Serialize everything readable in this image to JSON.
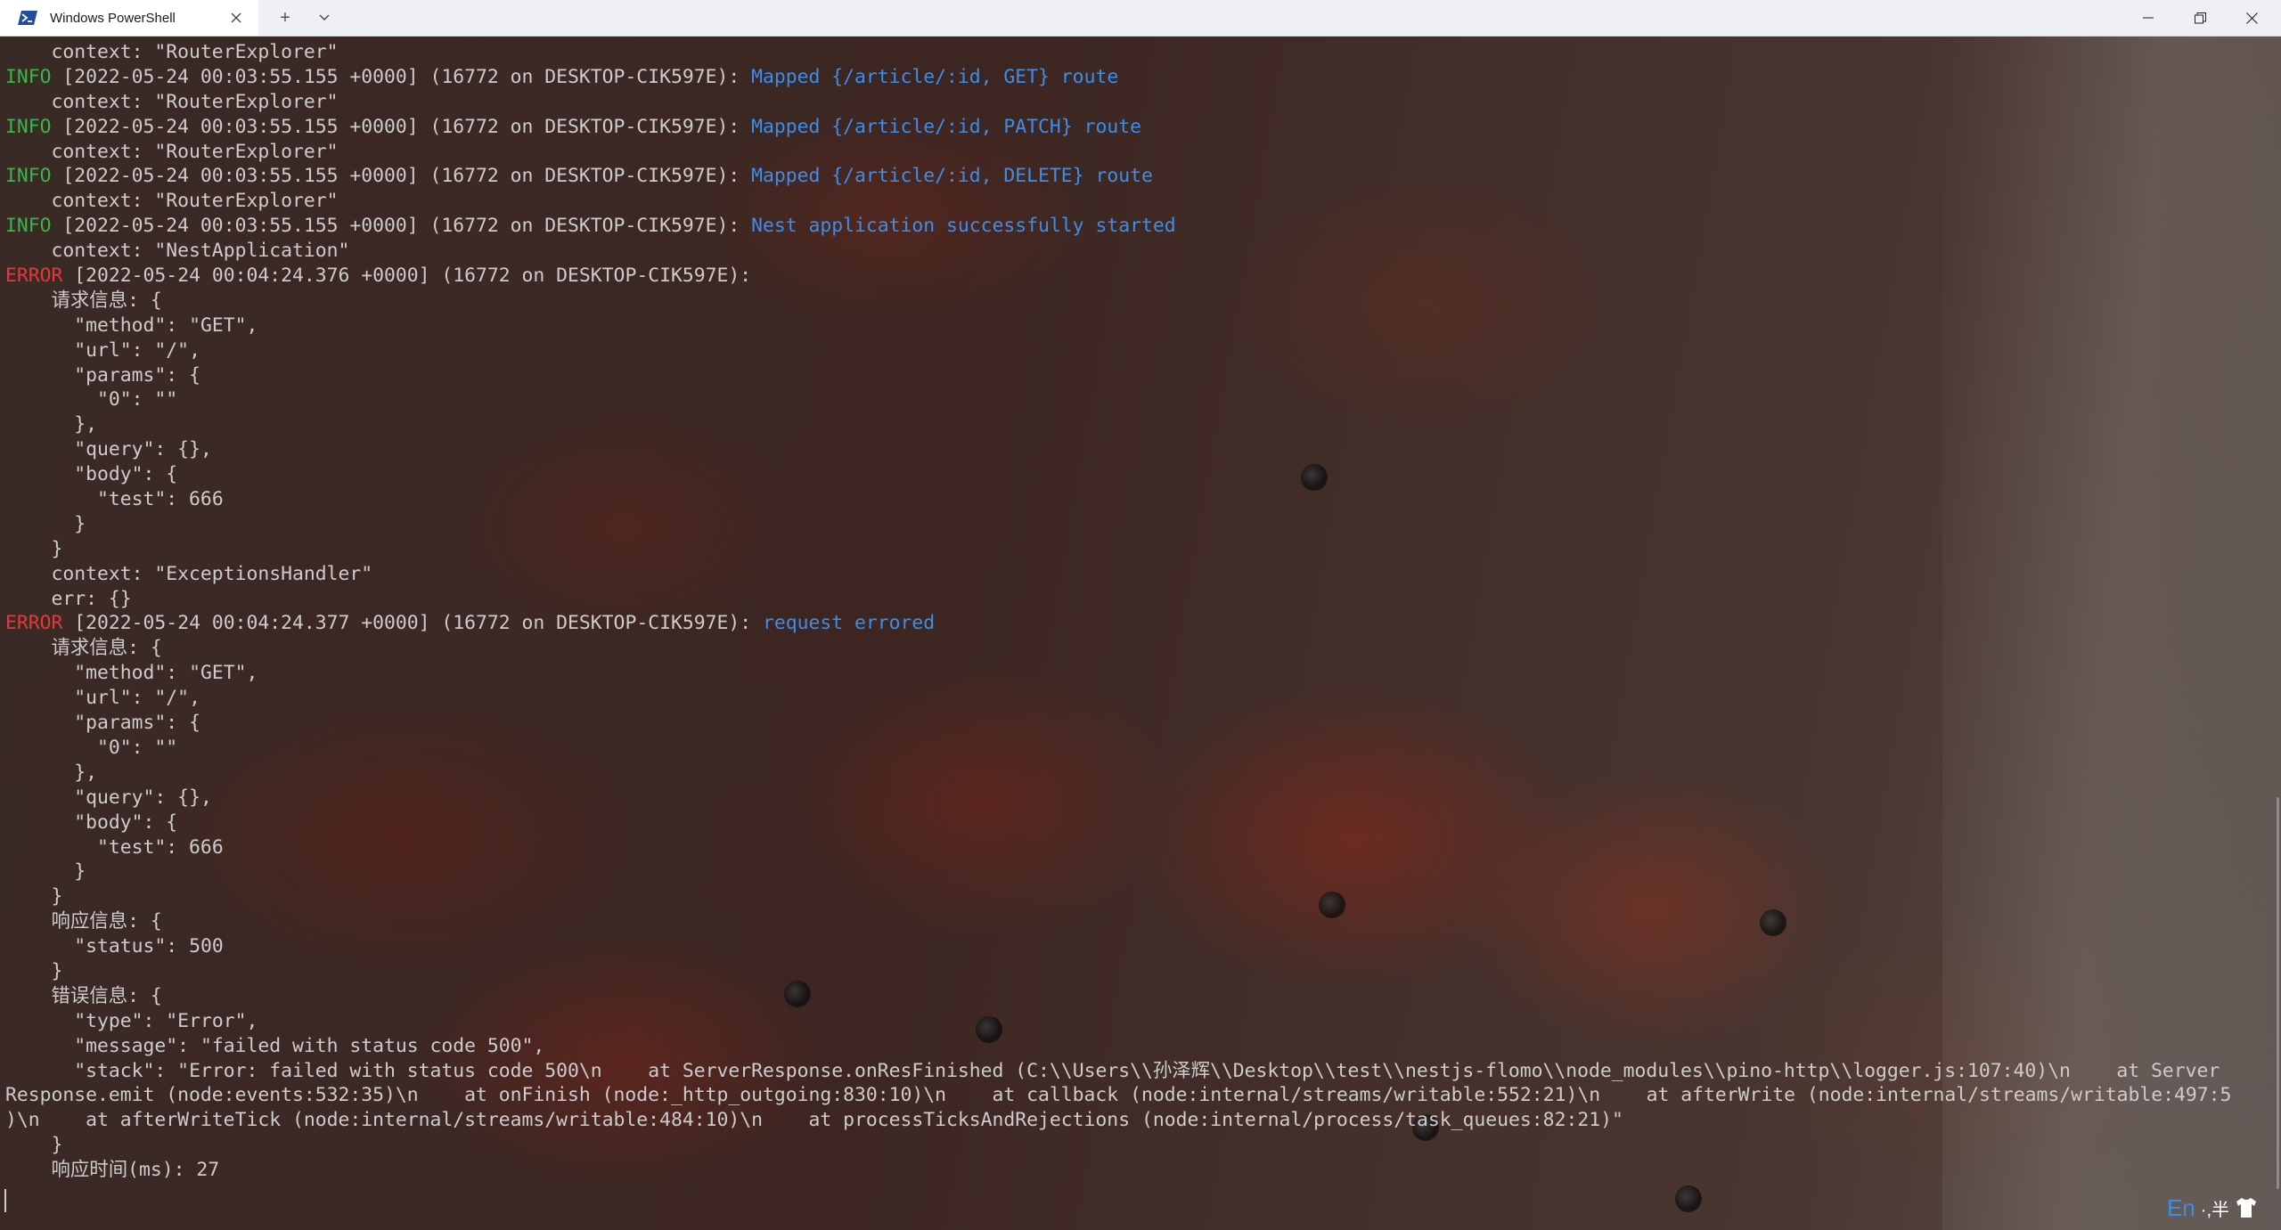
{
  "window": {
    "tab_title": "Windows PowerShell",
    "new_tab_symbol": "+",
    "dropdown_icon": "chevron-down-icon"
  },
  "terminal": {
    "lines": [
      {
        "indent": "    ",
        "level": "",
        "text": "context: \"RouterExplorer\"",
        "msg": ""
      },
      {
        "indent": "",
        "level": "INFO",
        "text": " [2022-05-24 00:03:55.155 +0000] (16772 on DESKTOP-CIK597E): ",
        "msg": "Mapped {/article/:id, GET} route"
      },
      {
        "indent": "    ",
        "level": "",
        "text": "context: \"RouterExplorer\"",
        "msg": ""
      },
      {
        "indent": "",
        "level": "INFO",
        "text": " [2022-05-24 00:03:55.155 +0000] (16772 on DESKTOP-CIK597E): ",
        "msg": "Mapped {/article/:id, PATCH} route"
      },
      {
        "indent": "    ",
        "level": "",
        "text": "context: \"RouterExplorer\"",
        "msg": ""
      },
      {
        "indent": "",
        "level": "INFO",
        "text": " [2022-05-24 00:03:55.155 +0000] (16772 on DESKTOP-CIK597E): ",
        "msg": "Mapped {/article/:id, DELETE} route"
      },
      {
        "indent": "    ",
        "level": "",
        "text": "context: \"RouterExplorer\"",
        "msg": ""
      },
      {
        "indent": "",
        "level": "INFO",
        "text": " [2022-05-24 00:03:55.155 +0000] (16772 on DESKTOP-CIK597E): ",
        "msg": "Nest application successfully started"
      },
      {
        "indent": "    ",
        "level": "",
        "text": "context: \"NestApplication\"",
        "msg": ""
      },
      {
        "indent": "",
        "level": "ERROR",
        "text": " [2022-05-24 00:04:24.376 +0000] (16772 on DESKTOP-CIK597E):",
        "msg": ""
      },
      {
        "indent": "    ",
        "level": "",
        "text": "请求信息: {",
        "msg": ""
      },
      {
        "indent": "      ",
        "level": "",
        "text": "\"method\": \"GET\",",
        "msg": ""
      },
      {
        "indent": "      ",
        "level": "",
        "text": "\"url\": \"/\",",
        "msg": ""
      },
      {
        "indent": "      ",
        "level": "",
        "text": "\"params\": {",
        "msg": ""
      },
      {
        "indent": "        ",
        "level": "",
        "text": "\"0\": \"\"",
        "msg": ""
      },
      {
        "indent": "      ",
        "level": "",
        "text": "},",
        "msg": ""
      },
      {
        "indent": "      ",
        "level": "",
        "text": "\"query\": {},",
        "msg": ""
      },
      {
        "indent": "      ",
        "level": "",
        "text": "\"body\": {",
        "msg": ""
      },
      {
        "indent": "        ",
        "level": "",
        "text": "\"test\": 666",
        "msg": ""
      },
      {
        "indent": "      ",
        "level": "",
        "text": "}",
        "msg": ""
      },
      {
        "indent": "    ",
        "level": "",
        "text": "}",
        "msg": ""
      },
      {
        "indent": "    ",
        "level": "",
        "text": "context: \"ExceptionsHandler\"",
        "msg": ""
      },
      {
        "indent": "    ",
        "level": "",
        "text": "err: {}",
        "msg": ""
      },
      {
        "indent": "",
        "level": "ERROR",
        "text": " [2022-05-24 00:04:24.377 +0000] (16772 on DESKTOP-CIK597E): ",
        "msg": "request errored"
      },
      {
        "indent": "    ",
        "level": "",
        "text": "请求信息: {",
        "msg": ""
      },
      {
        "indent": "      ",
        "level": "",
        "text": "\"method\": \"GET\",",
        "msg": ""
      },
      {
        "indent": "      ",
        "level": "",
        "text": "\"url\": \"/\",",
        "msg": ""
      },
      {
        "indent": "      ",
        "level": "",
        "text": "\"params\": {",
        "msg": ""
      },
      {
        "indent": "        ",
        "level": "",
        "text": "\"0\": \"\"",
        "msg": ""
      },
      {
        "indent": "      ",
        "level": "",
        "text": "},",
        "msg": ""
      },
      {
        "indent": "      ",
        "level": "",
        "text": "\"query\": {},",
        "msg": ""
      },
      {
        "indent": "      ",
        "level": "",
        "text": "\"body\": {",
        "msg": ""
      },
      {
        "indent": "        ",
        "level": "",
        "text": "\"test\": 666",
        "msg": ""
      },
      {
        "indent": "      ",
        "level": "",
        "text": "}",
        "msg": ""
      },
      {
        "indent": "    ",
        "level": "",
        "text": "}",
        "msg": ""
      },
      {
        "indent": "    ",
        "level": "",
        "text": "响应信息: {",
        "msg": ""
      },
      {
        "indent": "      ",
        "level": "",
        "text": "\"status\": 500",
        "msg": ""
      },
      {
        "indent": "    ",
        "level": "",
        "text": "}",
        "msg": ""
      },
      {
        "indent": "    ",
        "level": "",
        "text": "错误信息: {",
        "msg": ""
      },
      {
        "indent": "      ",
        "level": "",
        "text": "\"type\": \"Error\",",
        "msg": ""
      },
      {
        "indent": "      ",
        "level": "",
        "text": "\"message\": \"failed with status code 500\",",
        "msg": ""
      },
      {
        "indent": "      ",
        "level": "",
        "text": "\"stack\": \"Error: failed with status code 500\\n    at ServerResponse.onResFinished (C:\\\\Users\\\\孙泽辉\\\\Desktop\\\\test\\\\nestjs-flomo\\\\node_modules\\\\pino-http\\\\logger.js:107:40)\\n    at Server",
        "msg": ""
      },
      {
        "indent": "",
        "level": "",
        "text": "Response.emit (node:events:532:35)\\n    at onFinish (node:_http_outgoing:830:10)\\n    at callback (node:internal/streams/writable:552:21)\\n    at afterWrite (node:internal/streams/writable:497:5",
        "msg": ""
      },
      {
        "indent": "",
        "level": "",
        "text": ")\\n    at afterWriteTick (node:internal/streams/writable:484:10)\\n    at processTicksAndRejections (node:internal/process/task_queues:82:21)\"",
        "msg": ""
      },
      {
        "indent": "    ",
        "level": "",
        "text": "}",
        "msg": ""
      },
      {
        "indent": "    ",
        "level": "",
        "text": "响应时间(ms): 27",
        "msg": ""
      }
    ]
  },
  "ime": {
    "lang": "En",
    "rest": "·,半",
    "icon": "shirt-icon"
  },
  "colors": {
    "info": "#3ab54a",
    "error": "#e5383b",
    "message": "#3b8eea",
    "text": "#cccccc"
  }
}
